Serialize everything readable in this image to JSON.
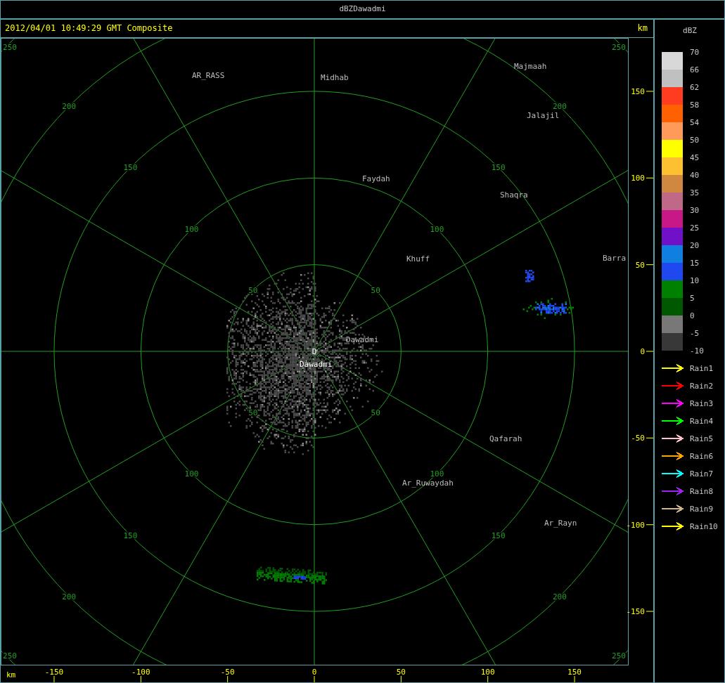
{
  "window": {
    "title": "dBZDawadmi"
  },
  "header": {
    "timestamp": "2012/04/01 10:49:29 GMT Composite",
    "unit": "km"
  },
  "range_rings": [
    {
      "labels": [
        "50",
        "50",
        "50",
        "50"
      ]
    },
    {
      "labels": [
        "100",
        "100",
        "100",
        "100"
      ]
    },
    {
      "labels": [
        "150",
        "150",
        "150",
        "150"
      ]
    },
    {
      "labels": [
        "200",
        "200",
        "200",
        "200"
      ]
    },
    {
      "labels": [
        "250",
        "250",
        "250",
        "250"
      ]
    }
  ],
  "site_marker": "D",
  "cities": [
    {
      "name": "AR_RASS",
      "kind": "town"
    },
    {
      "name": "Midhab",
      "kind": "town"
    },
    {
      "name": "Majmaah",
      "kind": "town"
    },
    {
      "name": "Jalajil",
      "kind": "town"
    },
    {
      "name": "Faydah",
      "kind": "town"
    },
    {
      "name": "Shaqra",
      "kind": "town"
    },
    {
      "name": "Khuff",
      "kind": "town"
    },
    {
      "name": "Barra",
      "kind": "town"
    },
    {
      "name": "Dawadmi",
      "kind": "town"
    },
    {
      "name": "Dawadmi",
      "kind": "site"
    },
    {
      "name": "Qafarah",
      "kind": "town"
    },
    {
      "name": "Ar_Ruwaydah",
      "kind": "town"
    },
    {
      "name": "Ar_Rayn",
      "kind": "town"
    }
  ],
  "y_axis": {
    "labels": [
      "150",
      "100",
      "50",
      "0",
      "-50",
      "-100",
      "-150"
    ]
  },
  "x_axis": {
    "unit": "km",
    "labels": [
      "-150",
      "-100",
      "-50",
      "0",
      "50",
      "100",
      "150"
    ]
  },
  "legend": {
    "title": "dBZ",
    "bins": [
      {
        "color": "#d8d8d8"
      },
      {
        "color": "#c0c0c0"
      },
      {
        "color": "#ff3c20"
      },
      {
        "color": "#ff6000"
      },
      {
        "color": "#ff9a5a"
      },
      {
        "color": "#ffff00"
      },
      {
        "color": "#fcc030"
      },
      {
        "color": "#d08840"
      },
      {
        "color": "#c06888"
      },
      {
        "color": "#c81888"
      },
      {
        "color": "#7010c8"
      },
      {
        "color": "#1080e0"
      },
      {
        "color": "#2048f0"
      },
      {
        "color": "#008000"
      },
      {
        "color": "#005800"
      },
      {
        "color": "#787878"
      },
      {
        "color": "#383838"
      }
    ],
    "labels": [
      "70",
      "66",
      "62",
      "58",
      "54",
      "50",
      "45",
      "40",
      "35",
      "30",
      "25",
      "20",
      "15",
      "10",
      "5",
      "0",
      "-5",
      "-10"
    ],
    "tracks": [
      {
        "name": "Rain1",
        "color": "#ffff00"
      },
      {
        "name": "Rain2",
        "color": "#ff0000"
      },
      {
        "name": "Rain3",
        "color": "#ff00ff"
      },
      {
        "name": "Rain4",
        "color": "#00ff00"
      },
      {
        "name": "Rain5",
        "color": "#ffc0cb"
      },
      {
        "name": "Rain6",
        "color": "#ffa500"
      },
      {
        "name": "Rain7",
        "color": "#00ffff"
      },
      {
        "name": "Rain8",
        "color": "#a020f0"
      },
      {
        "name": "Rain9",
        "color": "#d2b48c"
      },
      {
        "name": "Rain10",
        "color": "#ffff00"
      }
    ]
  }
}
